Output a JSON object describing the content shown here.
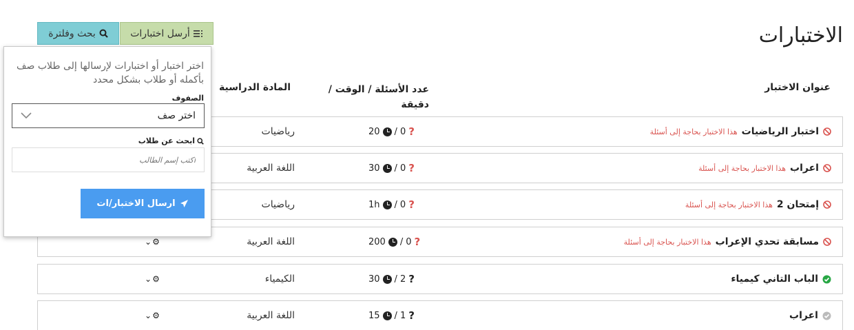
{
  "page": {
    "title": "الاختبارات"
  },
  "toolbar": {
    "send_label": "أرسل اختبارات",
    "filter_label": "بحث وفلترة"
  },
  "table": {
    "headers": {
      "title": "عنوان الاختبار",
      "count": "عدد الأسئلة / الوقت / دقيقة",
      "subject": "المادة الدراسية"
    },
    "rows": [
      {
        "status": "blocked",
        "name": "اختبار الرياضيات",
        "warning": "هذا الاختبار بحاجة إلى أسئلة",
        "questions": "0",
        "time": "20",
        "subject": "رياضيات"
      },
      {
        "status": "blocked",
        "name": "اعراب",
        "warning": "هذا الاختبار بحاجة إلى أسئلة",
        "questions": "0",
        "time": "30",
        "subject": "اللغة العربية"
      },
      {
        "status": "blocked",
        "name": "إمتحان 2",
        "warning": "هذا الاختبار بحاجة إلى أسئلة",
        "questions": "0",
        "time": "1h",
        "subject": "رياضيات"
      },
      {
        "status": "blocked",
        "name": "مسابقة تحدي الإعراب",
        "warning": "هذا الاختبار بحاجة إلى أسئلة",
        "questions": "0",
        "time": "200",
        "subject": "اللغة العربية"
      },
      {
        "status": "active",
        "name": "الباب التاني كيمياء",
        "warning": "",
        "questions": "2",
        "time": "30",
        "subject": "الكيمياء"
      },
      {
        "status": "inactive",
        "name": "اعراب",
        "warning": "",
        "questions": "1",
        "time": "15",
        "subject": "اللغة العربية"
      }
    ]
  },
  "send_panel": {
    "description": "اختر اختبار أو اختبارات لإرسالها إلى طلاب صف بأكمله أو طلاب بشكل محدد",
    "grades_label": "الصفوف",
    "grade_select_value": "اختر صف",
    "student_search_label": "ابحث عن طلاب",
    "student_search_placeholder": "اكتب إسم الطالب",
    "submit_label": "ارسال الاختبار/ات"
  },
  "colors": {
    "send_button": "#c6dcaa",
    "filter_button": "#7fcdd5",
    "submit_button": "#4a9cf0",
    "warning": "#d9534f",
    "active": "#28a745",
    "inactive": "#bbbbbb"
  }
}
